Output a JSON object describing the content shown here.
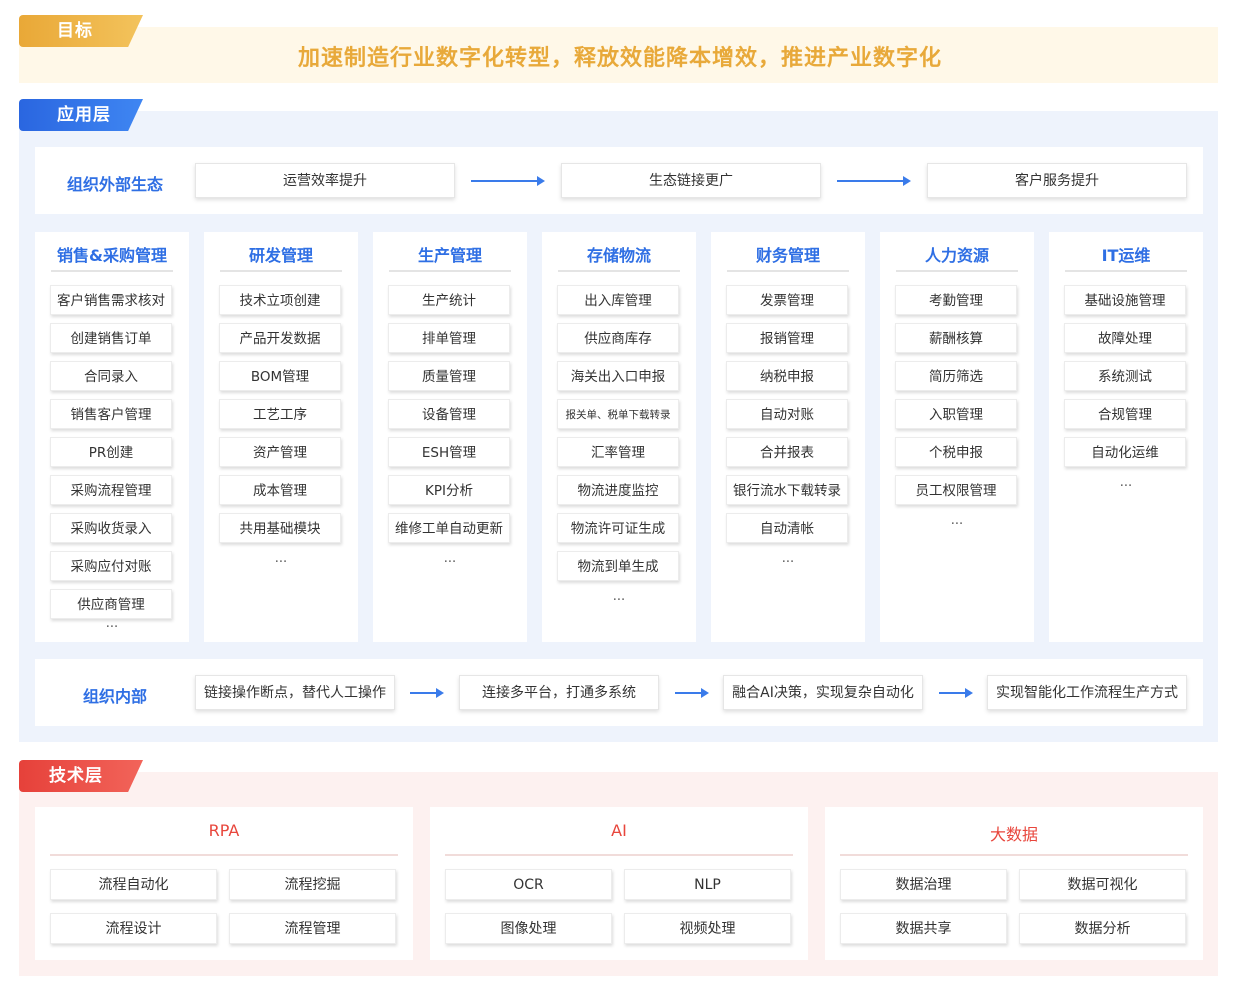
{
  "goal": {
    "tag": "目标",
    "text": "加速制造行业数字化转型，释放效能降本增效，推进产业数字化"
  },
  "app": {
    "tag": "应用层",
    "external": {
      "label": "组织外部生态",
      "steps": [
        "运营效率提升",
        "生态链接更广",
        "客户服务提升"
      ]
    },
    "columns": [
      {
        "title": "销售&采购管理",
        "items": [
          "客户销售需求核对",
          "创建销售订单",
          "合同录入",
          "销售客户管理",
          "PR创建",
          "采购流程管理",
          "采购收货录入",
          "采购应付对账",
          "供应商管理"
        ],
        "more": "···"
      },
      {
        "title": "研发管理",
        "items": [
          "技术立项创建",
          "产品开发数据",
          "BOM管理",
          "工艺工序",
          "资产管理",
          "成本管理",
          "共用基础模块"
        ],
        "more": "···"
      },
      {
        "title": "生产管理",
        "items": [
          "生产统计",
          "排单管理",
          "质量管理",
          "设备管理",
          "ESH管理",
          "KPI分析",
          "维修工单自动更新"
        ],
        "more": "···"
      },
      {
        "title": "存储物流",
        "items": [
          "出入库管理",
          "供应商库存",
          "海关出入口申报",
          "报关单、税单下载转录",
          "汇率管理",
          "物流进度监控",
          "物流许可证生成",
          "物流到单生成"
        ],
        "more": "···"
      },
      {
        "title": "财务管理",
        "items": [
          "发票管理",
          "报销管理",
          "纳税申报",
          "自动对账",
          "合并报表",
          "银行流水下载转录",
          "自动清帐"
        ],
        "more": "···"
      },
      {
        "title": "人力资源",
        "items": [
          "考勤管理",
          "薪酬核算",
          "简历筛选",
          "入职管理",
          "个税申报",
          "员工权限管理"
        ],
        "more": "···"
      },
      {
        "title": "IT运维",
        "items": [
          "基础设施管理",
          "故障处理",
          "系统测试",
          "合规管理",
          "自动化运维"
        ],
        "more": "···"
      }
    ],
    "internal": {
      "label": "组织内部",
      "steps": [
        "链接操作断点，替代人工操作",
        "连接多平台，打通多系统",
        "融合AI决策，实现复杂自动化",
        "实现智能化工作流程生产方式"
      ]
    }
  },
  "tech": {
    "tag": "技术层",
    "groups": [
      {
        "title": "RPA",
        "items": [
          "流程自动化",
          "流程挖掘",
          "流程设计",
          "流程管理"
        ]
      },
      {
        "title": "AI",
        "items": [
          "OCR",
          "NLP",
          "图像处理",
          "视频处理"
        ]
      },
      {
        "title": "大数据",
        "items": [
          "数据治理",
          "数据可视化",
          "数据共享",
          "数据分析"
        ]
      }
    ]
  },
  "colors": {
    "goal_tag": "#e9a837",
    "app_tag": "#2f6fe4",
    "tech_tag": "#e8463c",
    "accent_blue": "#2f6fe4",
    "accent_red": "#e8463c",
    "goal_text": "#e8a93a"
  }
}
